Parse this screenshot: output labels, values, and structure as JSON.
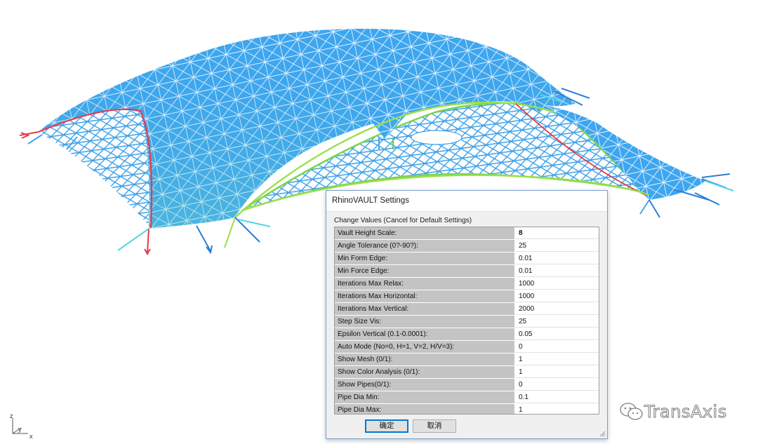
{
  "dialog": {
    "title": "RhinoVAULT Settings",
    "group_label": "Change Values (Cancel for Default Settings)",
    "settings": [
      {
        "label": "Vault Height Scale:",
        "value": "8"
      },
      {
        "label": "Angle Tolerance (0?-90?):",
        "value": "25"
      },
      {
        "label": "Min Form Edge:",
        "value": "0.01"
      },
      {
        "label": "Min Force Edge:",
        "value": "0.01"
      },
      {
        "label": "Iterations Max Relax:",
        "value": "1000"
      },
      {
        "label": "Iterations Max Horizontal:",
        "value": "1000"
      },
      {
        "label": "Iterations Max Vertical:",
        "value": "2000"
      },
      {
        "label": "Step Size Vis:",
        "value": "25"
      },
      {
        "label": "Epsilon Vertical (0.1-0.0001):",
        "value": "0.05"
      },
      {
        "label": "Auto Mode (No=0, H=1, V=2, H/V=3):",
        "value": "0"
      },
      {
        "label": "Show Mesh (0/1):",
        "value": "1"
      },
      {
        "label": "Show Color Analysis (0/1):",
        "value": "1"
      },
      {
        "label": "Show Pipes(0/1):",
        "value": "0"
      },
      {
        "label": "Pipe Dia Min:",
        "value": "0.1"
      },
      {
        "label": "Pipe Dia Max:",
        "value": "1"
      }
    ],
    "ok_label": "确定",
    "cancel_label": "取消"
  },
  "axes": {
    "z": "z",
    "y": "y",
    "x": "x"
  },
  "watermark": {
    "text": "TransAxis",
    "icon": "wechat-icon"
  },
  "colors": {
    "shell": "#3fa7f0",
    "mesh_lines": "#e8f4ff",
    "edge_red": "#e83a4c",
    "edge_green": "#9be04a",
    "dialog_border": "#7a9fcf",
    "label_bg": "#c4c4c4"
  }
}
